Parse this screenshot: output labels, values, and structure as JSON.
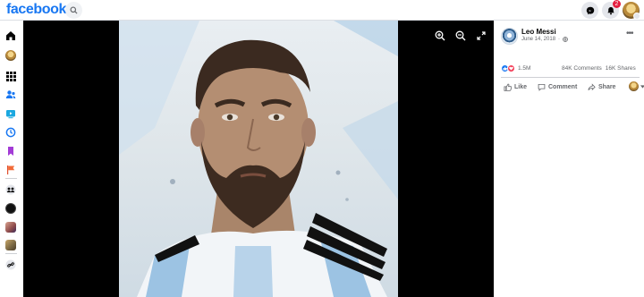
{
  "header": {
    "logo_text": "facebook",
    "notification_count": "2",
    "icons": [
      "search-icon",
      "messenger-icon",
      "bell-icon",
      "profile-avatar"
    ]
  },
  "sidebar": {
    "items": [
      "home-icon",
      "profile-avatar",
      "menu-grid-icon",
      "friends-icon",
      "watch-icon",
      "memories-icon",
      "saved-icon",
      "pages-icon",
      "groups-icon",
      "shortcut-1",
      "shortcut-2",
      "shortcut-3",
      "link-icon"
    ]
  },
  "viewer": {
    "controls": [
      "zoom-in-icon",
      "zoom-out-icon",
      "fullscreen-icon"
    ]
  },
  "post": {
    "author": "Leo Messi",
    "date": "June 14, 2018",
    "privacy_icon": "globe-icon",
    "reaction_count": "1.5M",
    "comments": "84K Comments",
    "shares": "16K Shares",
    "actions": {
      "like": "Like",
      "comment": "Comment",
      "share": "Share"
    }
  },
  "colors": {
    "brand": "#1877f2",
    "viewer_bg": "#000000",
    "badge": "#e41e3f",
    "love": "#f33e58"
  }
}
